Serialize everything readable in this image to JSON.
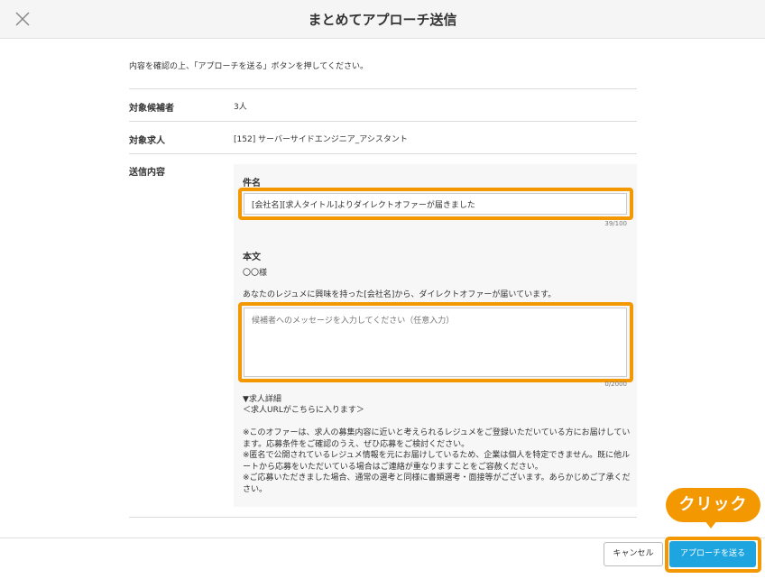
{
  "header": {
    "title": "まとめてアプローチ送信",
    "close_icon": "close-icon"
  },
  "intro": "内容を確認の上、「アプローチを送る」ボタンを押してください。",
  "rows": {
    "candidates": {
      "label": "対象候補者",
      "value": "3人"
    },
    "job": {
      "label": "対象求人",
      "value": "[152] サーバーサイドエンジニア_アシスタント"
    },
    "content": {
      "label": "送信内容"
    }
  },
  "subject": {
    "label": "件名",
    "value": "[会社名][求人タイトル]よりダイレクトオファーが届きました",
    "counter": "39/100"
  },
  "body": {
    "label": "本文",
    "salutation": "〇〇様",
    "line1": "あなたのレジュメに興味を持った[会社名]から、ダイレクトオファーが届いています。",
    "message_placeholder": "候補者へのメッセージを入力してください（任意入力）",
    "counter": "0/2000"
  },
  "details": {
    "heading": "▼求人詳細",
    "url_note": "＜求人URLがこちらに入ります＞",
    "notice1": "※このオファーは、求人の募集内容に近いと考えられるレジュメをご登録いただいている方にお届けしています。応募条件をご確認のうえ、ぜひ応募をご検討ください。",
    "notice2": "※匿名で公開されているレジュメ情報を元にお届けしているため、企業は個人を特定できません。既に他ルートから応募をいただいている場合はご連絡が重なりますことをご容赦ください。",
    "notice3": "※ご応募いただきました場合、通常の選考と同様に書類選考・面接等がございます。あらかじめご了承ください。"
  },
  "footer": {
    "cancel_label": "キャンセル",
    "send_label": "アプローチを送る"
  },
  "annotation": {
    "click_label": "クリック",
    "highlight_color": "#f39800"
  },
  "colors": {
    "accent": "#1ea5e0",
    "highlight": "#f39800"
  }
}
